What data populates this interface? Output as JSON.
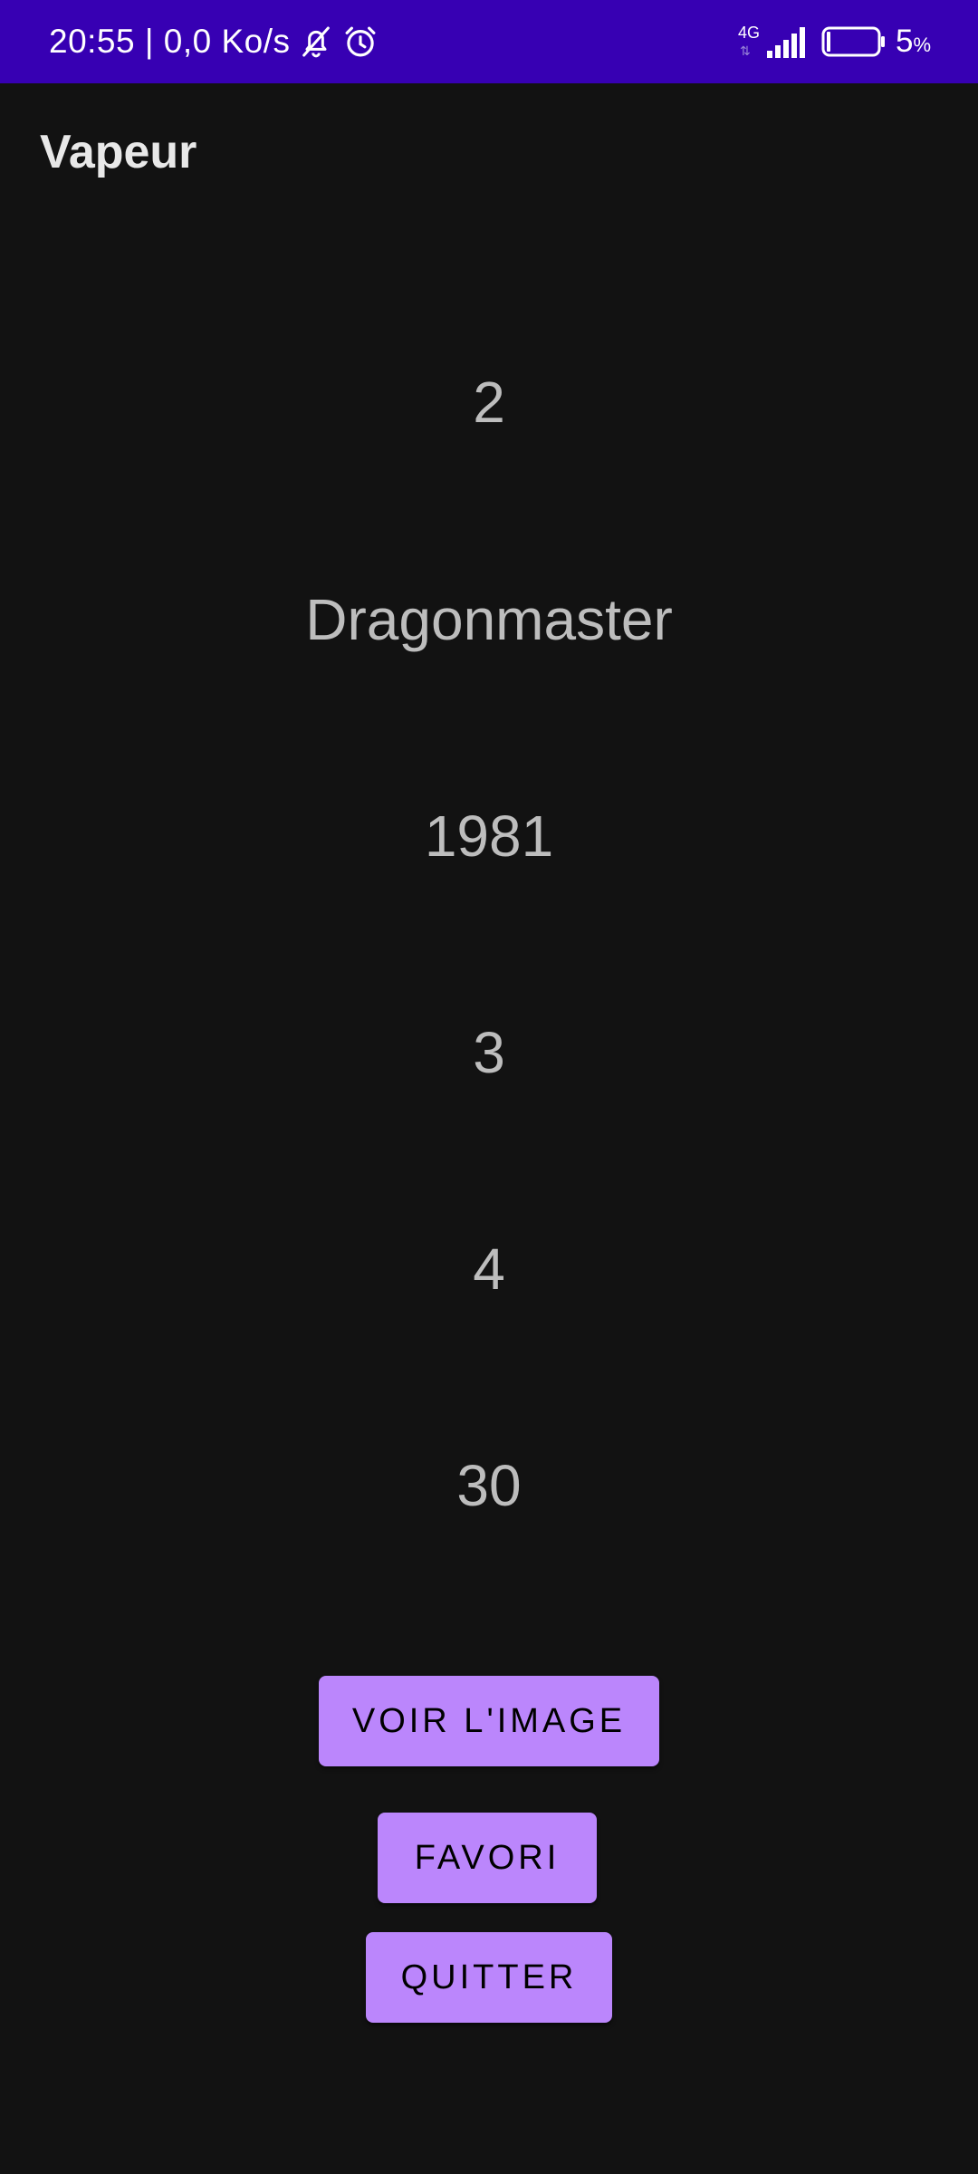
{
  "status_bar": {
    "time": "20:55",
    "separator": " | ",
    "network_speed": "0,0 Ko/s",
    "network_type": "4G",
    "battery_percent": "5",
    "battery_unit": "%",
    "background_color": "#3700B3",
    "icons": [
      "bell-off-icon",
      "alarm-icon",
      "signal-icon",
      "battery-icon"
    ]
  },
  "app": {
    "title": "Vapeur"
  },
  "details": {
    "line1": "2",
    "line2": "Dragonmaster",
    "line3": "1981",
    "line4": "3",
    "line5": "4",
    "line6": "30"
  },
  "buttons": {
    "view_image": "VOIR L'IMAGE",
    "favorite": "FAVORI",
    "quit": "QUITTER",
    "color": "#BB86FC"
  },
  "theme": {
    "background": "#121212",
    "text": "#bdbdbd"
  }
}
